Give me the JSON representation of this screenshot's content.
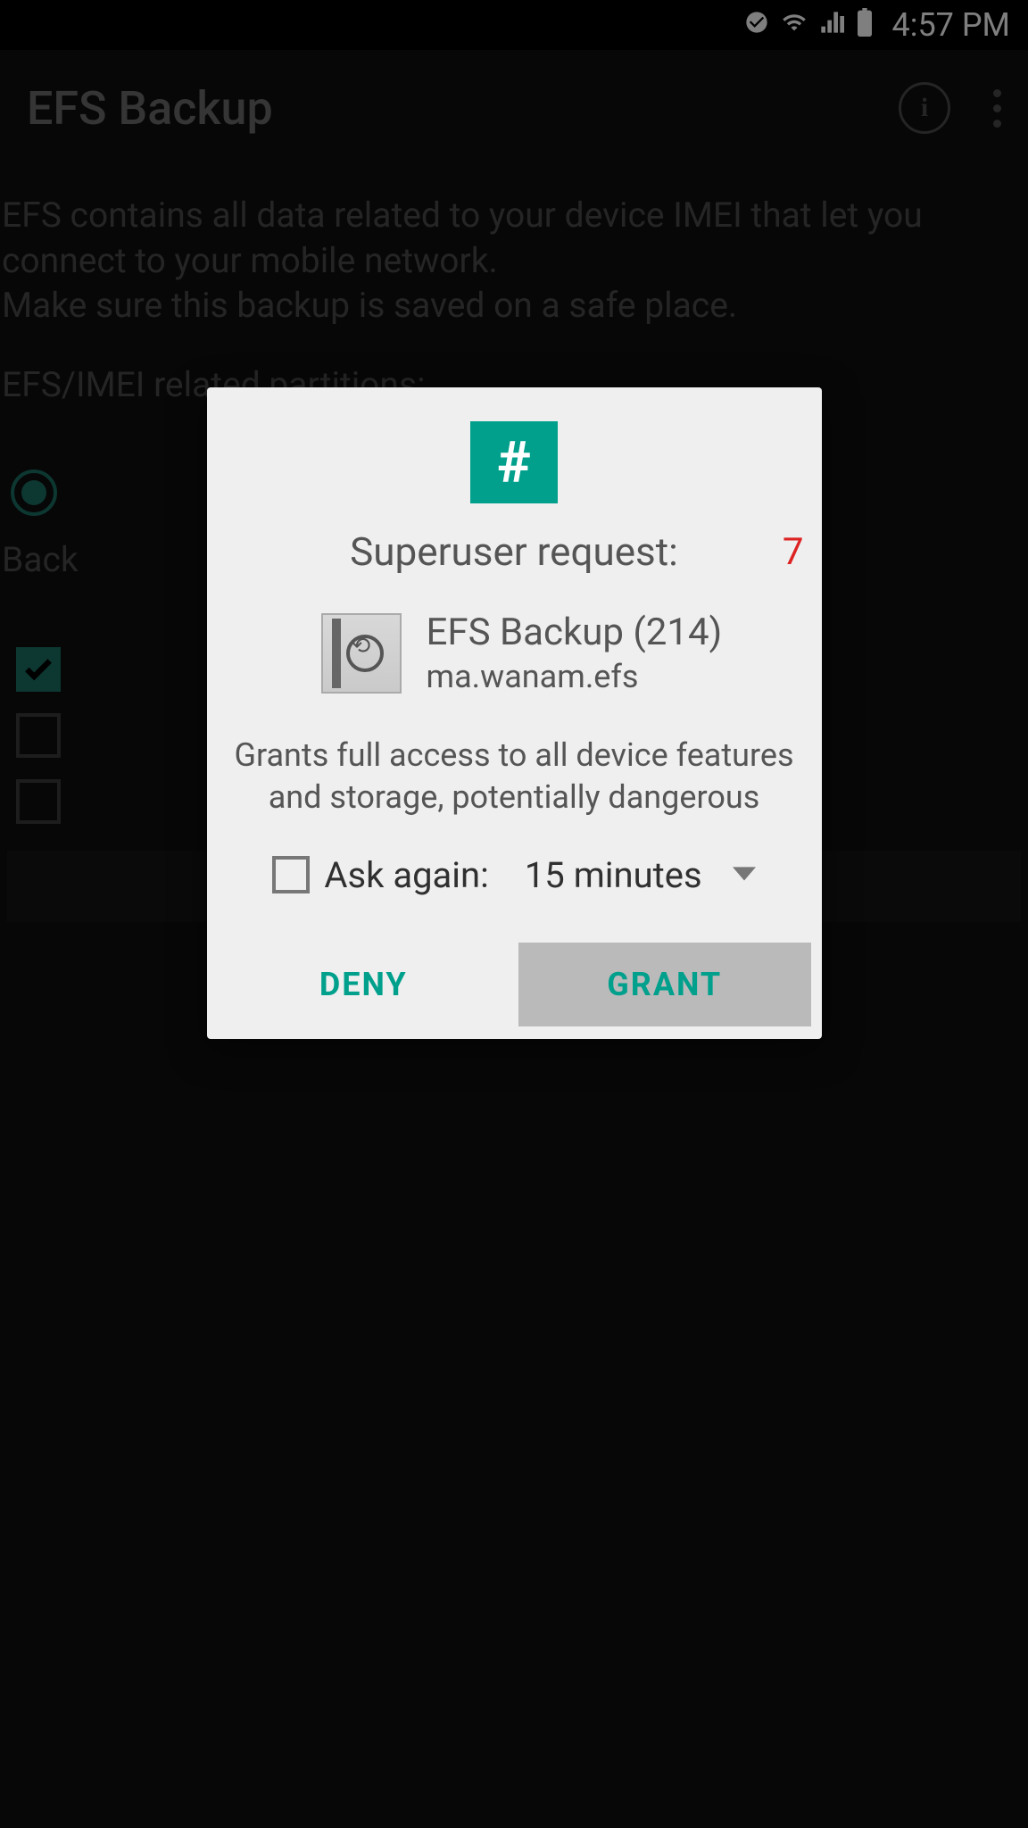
{
  "status_bar": {
    "time": "4:57 PM"
  },
  "app": {
    "title": "EFS Backup",
    "description": "EFS contains all data related to your device IMEI that let you connect to your mobile network.\nMake sure this backup is saved on a safe place.",
    "partitions_label": "EFS/IMEI related partitions:",
    "radio_label": "Back"
  },
  "dialog": {
    "title": "Superuser request:",
    "countdown": "7",
    "app_name": "EFS Backup (214)",
    "app_package": "ma.wanam.efs",
    "warning": "Grants full access to all device features and storage, potentially dangerous",
    "ask_again_label": "Ask again:",
    "ask_again_value": "15 minutes",
    "deny_label": "DENY",
    "grant_label": "GRANT"
  }
}
